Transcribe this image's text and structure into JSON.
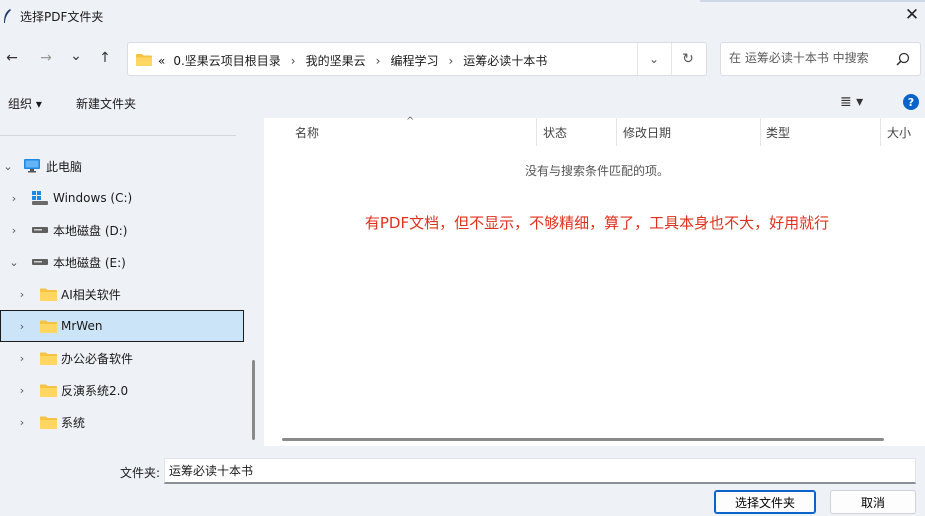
{
  "window": {
    "title": "选择PDF文件夹",
    "close_symbol": "✕"
  },
  "nav": {
    "back_symbol": "←",
    "forward_symbol": "→",
    "recent_symbol": "⌄",
    "up_symbol": "↑",
    "overflow_symbol": "«",
    "crumbs": [
      "0.坚果云项目根目录",
      "我的坚果云",
      "编程学习",
      "运筹必读十本书"
    ],
    "crumb_sep": "›",
    "dropdown_symbol": "⌄",
    "refresh_symbol": "↻"
  },
  "search": {
    "placeholder": "在 运筹必读十本书 中搜索"
  },
  "toolbar": {
    "organize_label": "组织 ▾",
    "new_folder_label": "新建文件夹",
    "view_symbol": "≣ ▾",
    "help_symbol": "?"
  },
  "tree": {
    "items": [
      {
        "label": "此电脑",
        "icon": "computer-icon",
        "expanded": true
      },
      {
        "label": "Windows (C:)",
        "icon": "windows-drive-icon",
        "expanded": false
      },
      {
        "label": "本地磁盘 (D:)",
        "icon": "drive-icon",
        "expanded": false
      },
      {
        "label": "本地磁盘 (E:)",
        "icon": "drive-icon",
        "expanded": true
      },
      {
        "label": "AI相关软件",
        "icon": "folder-icon",
        "expanded": false
      },
      {
        "label": "MrWen",
        "icon": "folder-icon",
        "expanded": false,
        "selected": true
      },
      {
        "label": "办公必备软件",
        "icon": "folder-icon",
        "expanded": false
      },
      {
        "label": "反演系统2.0",
        "icon": "folder-icon",
        "expanded": false
      },
      {
        "label": "系统",
        "icon": "folder-icon",
        "expanded": false
      }
    ]
  },
  "columns": {
    "name": "名称",
    "status": "状态",
    "modified": "修改日期",
    "type": "类型",
    "size": "大小",
    "sort_symbol": "^"
  },
  "content": {
    "empty_message": "没有与搜索条件匹配的项。",
    "annotation": "有PDF文档，但不显示，不够精细，算了，工具本身也不大，好用就行",
    "annotation_color": "#e0301e"
  },
  "footer": {
    "folder_label": "文件夹:",
    "folder_value": "运筹必读十本书",
    "select_button": "选择文件夹",
    "cancel_button": "取消"
  },
  "colors": {
    "accent": "#0a63c9",
    "selection": "#cce4f7",
    "folder": "#f5c242"
  }
}
